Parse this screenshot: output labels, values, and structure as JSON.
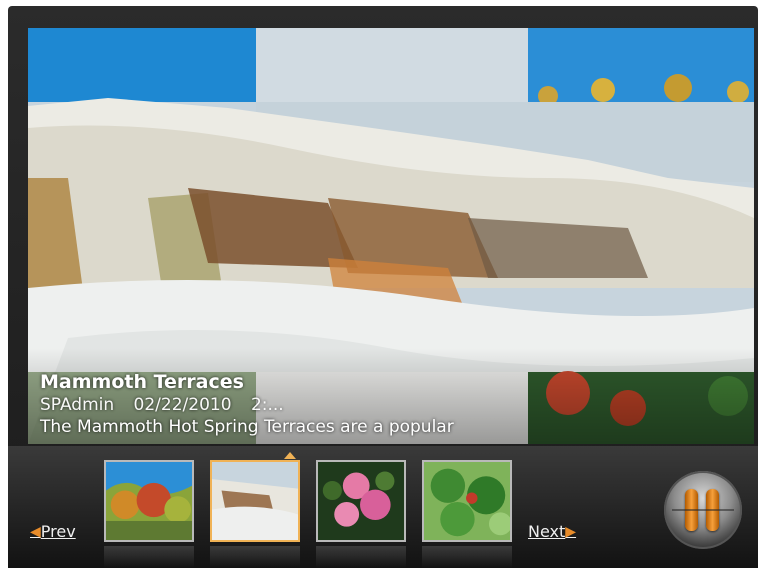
{
  "slide": {
    "title": "Mammoth Terraces",
    "author": "SPAdmin",
    "date": "02/22/2010",
    "time": "2:...",
    "description": "The Mammoth Hot Spring Terraces are a popular"
  },
  "nav": {
    "prev_label": "Prev",
    "next_label": "Next",
    "prev_icon": "triangle-left",
    "next_icon": "triangle-right"
  },
  "thumbnails": [
    {
      "subject": "autumn trees",
      "active": false
    },
    {
      "subject": "mammoth terraces",
      "active": true
    },
    {
      "subject": "pink flowers",
      "active": false
    },
    {
      "subject": "green leaves",
      "active": false
    }
  ],
  "controls": {
    "pause_icon": "pause-icon"
  },
  "colors": {
    "accent": "#f0b255",
    "pause_bar": "#f7a03b",
    "background": "#1c1c1c"
  }
}
